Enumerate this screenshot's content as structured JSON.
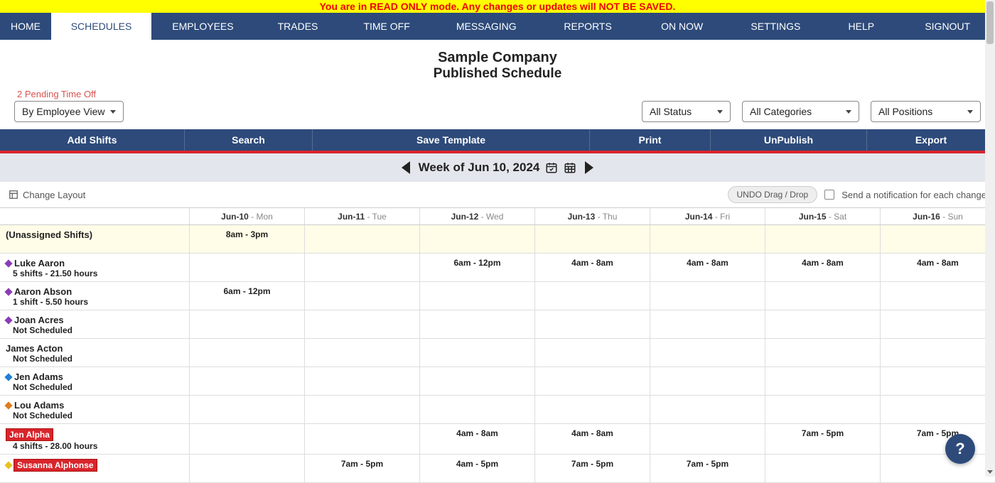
{
  "banner": "You are in READ ONLY mode. Any changes or updates will NOT BE SAVED.",
  "nav": [
    "HOME",
    "SCHEDULES",
    "EMPLOYEES",
    "TRADES",
    "TIME OFF",
    "MESSAGING",
    "REPORTS",
    "ON NOW",
    "SETTINGS",
    "HELP",
    "SIGNOUT"
  ],
  "nav_active": 1,
  "header": {
    "company": "Sample Company",
    "subtitle": "Published Schedule"
  },
  "pending_link": "2 Pending Time Off",
  "filters": {
    "view": "By Employee View",
    "status": "All Status",
    "categories": "All Categories",
    "positions": "All Positions"
  },
  "actions": [
    "Add Shifts",
    "Search",
    "Save Template",
    "Print",
    "UnPublish",
    "Export"
  ],
  "week_label": "Week of Jun 10, 2024",
  "change_layout": "Change Layout",
  "undo_label": "UNDO Drag / Drop",
  "notify_label": "Send a notification for each change",
  "days": [
    {
      "date": "Jun-10",
      "dow": "Mon"
    },
    {
      "date": "Jun-11",
      "dow": "Tue"
    },
    {
      "date": "Jun-12",
      "dow": "Wed"
    },
    {
      "date": "Jun-13",
      "dow": "Thu"
    },
    {
      "date": "Jun-14",
      "dow": "Fri"
    },
    {
      "date": "Jun-15",
      "dow": "Sat"
    },
    {
      "date": "Jun-16",
      "dow": "Sun"
    }
  ],
  "rows": [
    {
      "kind": "unassigned",
      "label": "(Unassigned Shifts)",
      "shifts": [
        "8am - 3pm",
        "",
        "",
        "",
        "",
        "",
        ""
      ]
    },
    {
      "kind": "emp",
      "name": "Luke Aaron",
      "sub": "5 shifts - 21.50 hours",
      "marker": "purple",
      "shifts": [
        "",
        "",
        "6am - 12pm",
        "4am - 8am",
        "4am - 8am",
        "4am - 8am",
        "4am - 8am"
      ]
    },
    {
      "kind": "emp",
      "name": "Aaron Abson",
      "sub": "1 shift - 5.50 hours",
      "marker": "purple",
      "shifts": [
        "6am - 12pm",
        "",
        "",
        "",
        "",
        "",
        ""
      ]
    },
    {
      "kind": "emp",
      "name": "Joan Acres",
      "sub": "Not Scheduled",
      "marker": "purple",
      "shifts": [
        "",
        "",
        "",
        "",
        "",
        "",
        ""
      ]
    },
    {
      "kind": "emp",
      "name": "James Acton",
      "sub": "Not Scheduled",
      "marker": "",
      "shifts": [
        "",
        "",
        "",
        "",
        "",
        "",
        ""
      ]
    },
    {
      "kind": "emp",
      "name": "Jen Adams",
      "sub": "Not Scheduled",
      "marker": "blue",
      "shifts": [
        "",
        "",
        "",
        "",
        "",
        "",
        ""
      ]
    },
    {
      "kind": "emp",
      "name": "Lou Adams",
      "sub": "Not Scheduled",
      "marker": "orange",
      "shifts": [
        "",
        "",
        "",
        "",
        "",
        "",
        ""
      ]
    },
    {
      "kind": "emp-badge",
      "name": "Jen Alpha",
      "sub": "4 shifts - 28.00 hours",
      "marker": "",
      "shifts": [
        "",
        "",
        "4am - 8am",
        "4am - 8am",
        "",
        "7am - 5pm",
        "7am - 5pm"
      ]
    },
    {
      "kind": "emp-badge",
      "name": "Susanna Alphonse",
      "sub": "",
      "marker": "yellow",
      "shifts": [
        "",
        "7am - 5pm",
        "4am - 5pm",
        "7am - 5pm",
        "7am - 5pm",
        "",
        ""
      ]
    }
  ],
  "help_fab": "?"
}
